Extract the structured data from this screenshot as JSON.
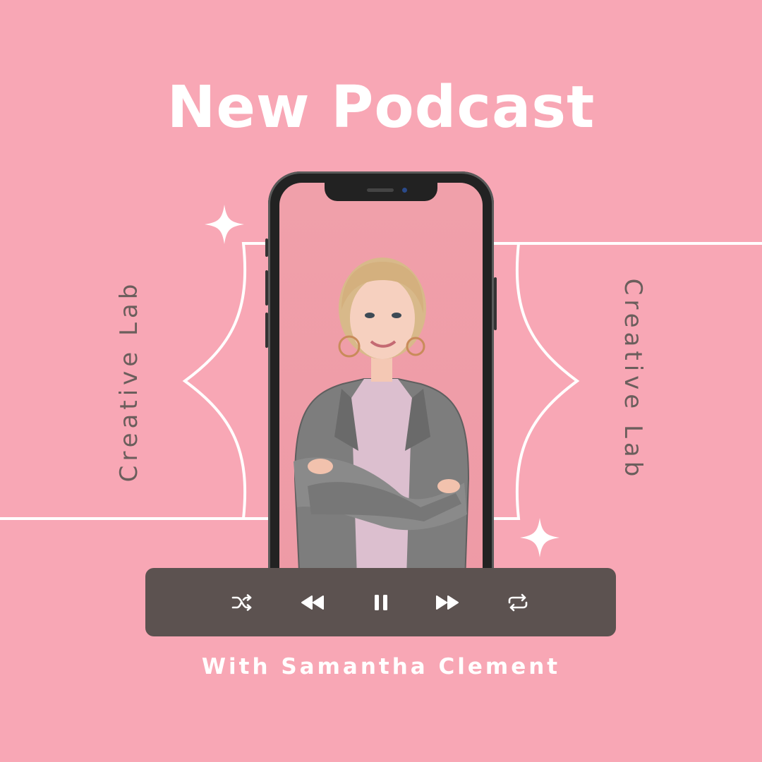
{
  "title": "New Podcast",
  "brand_left": "Creative Lab",
  "brand_right": "Creative Lab",
  "host_line": "With Samantha Clement",
  "player": {
    "controls": [
      "shuffle-icon",
      "rewind-icon",
      "pause-icon",
      "fast-forward-icon",
      "repeat-icon"
    ]
  },
  "colors": {
    "background": "#F8A7B5",
    "player_bar": "#5C5250",
    "text_light": "#FFFFFF",
    "text_dark": "#6B5E5C"
  }
}
